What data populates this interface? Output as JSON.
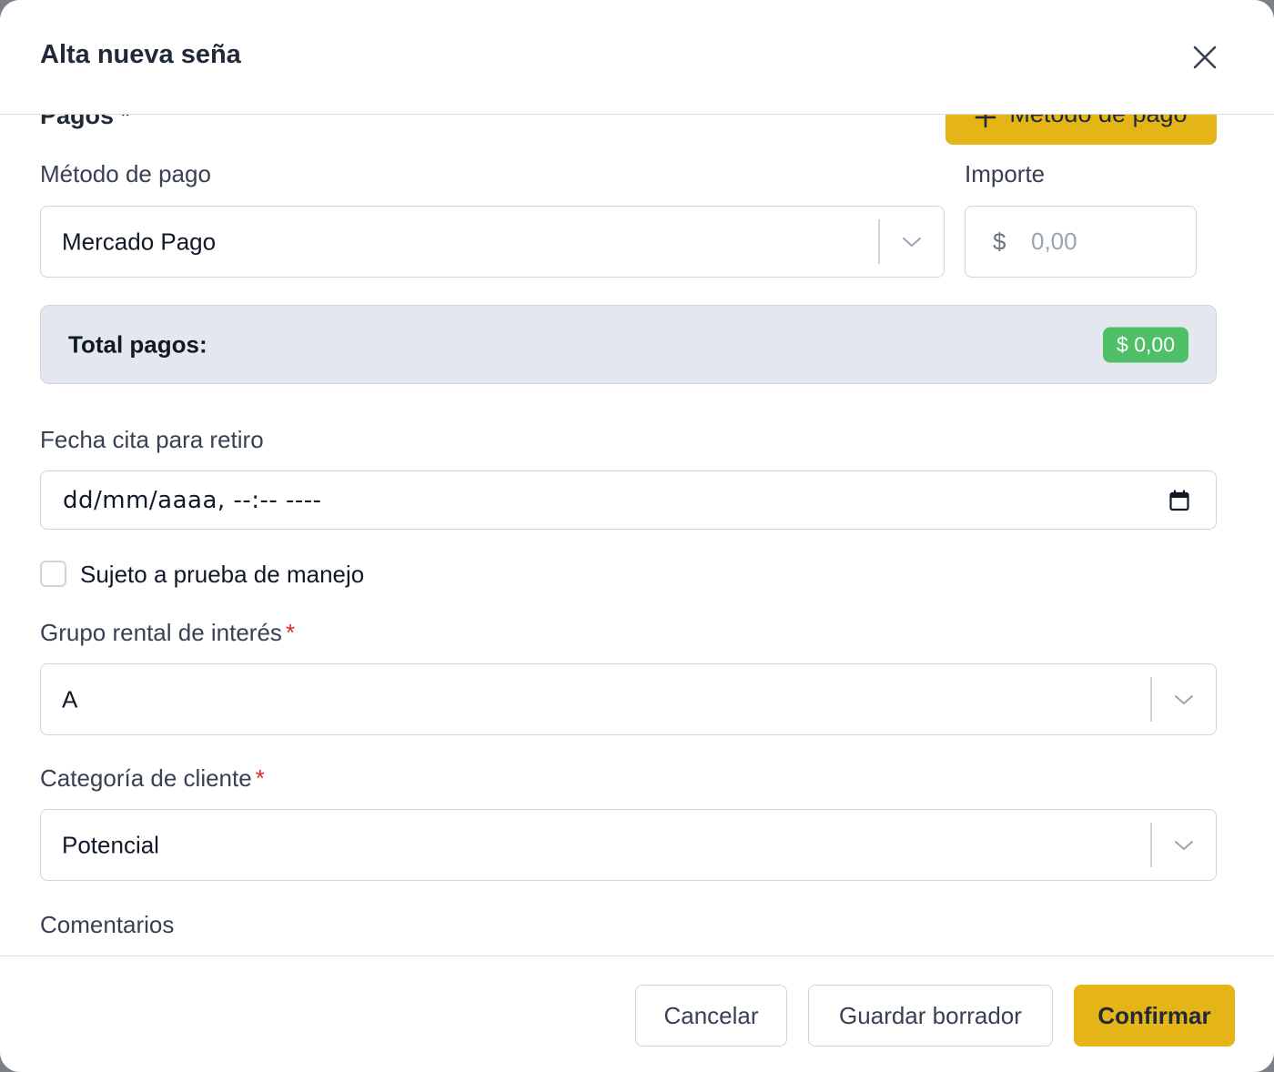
{
  "modal": {
    "title": "Alta nueva seña"
  },
  "payments": {
    "section_title": "Pagos *",
    "add_method_label": "Método de pago",
    "method_label": "Método de pago",
    "method_value": "Mercado Pago",
    "amount_label": "Importe",
    "currency_symbol": "$",
    "amount_placeholder": "0,00",
    "total_label": "Total pagos:",
    "total_value": "$ 0,00"
  },
  "appointment": {
    "label": "Fecha cita para retiro",
    "placeholder": "dd/mm/aaaa, --:-- ----"
  },
  "test_drive": {
    "label": "Sujeto a prueba de manejo",
    "checked": false
  },
  "rental_group": {
    "label": "Grupo rental de interés",
    "required_mark": "*",
    "value": "A"
  },
  "client_category": {
    "label": "Categoría de cliente",
    "required_mark": "*",
    "value": "Potencial"
  },
  "comments": {
    "label": "Comentarios"
  },
  "footer": {
    "cancel_label": "Cancelar",
    "draft_label": "Guardar borrador",
    "confirm_label": "Confirmar"
  },
  "colors": {
    "accent": "#e5b417",
    "success": "#4fbf67",
    "required": "#dc2626"
  }
}
